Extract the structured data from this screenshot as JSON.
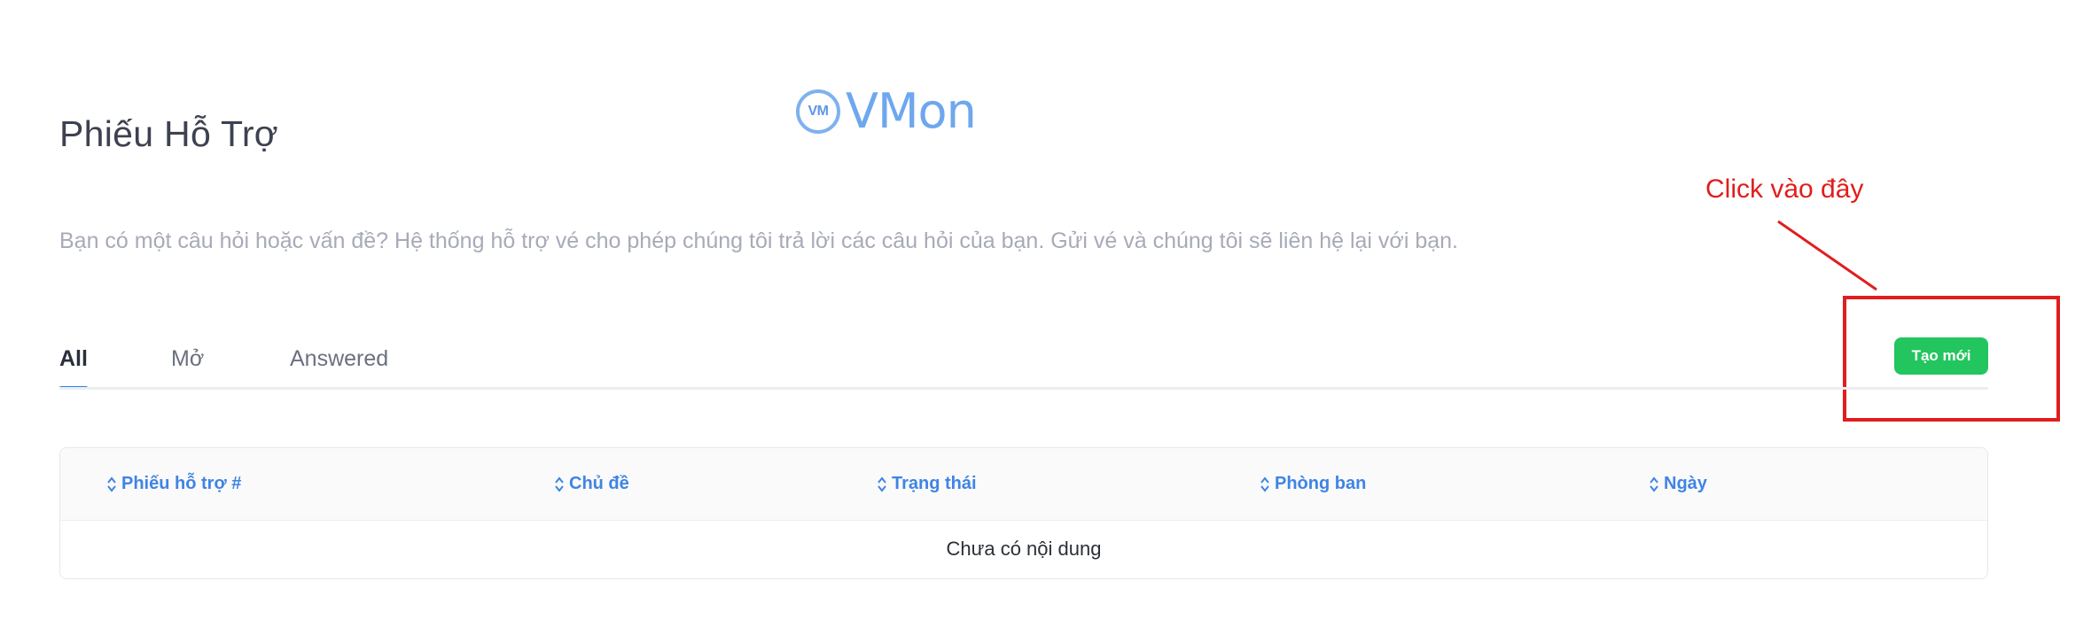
{
  "page": {
    "title": "Phiếu Hỗ Trợ",
    "description": "Bạn có một câu hỏi hoặc vấn đề? Hệ thống hỗ trợ vé cho phép chúng tôi trả lời các câu hỏi của bạn. Gửi vé và chúng tôi sẽ liên hệ lại với bạn."
  },
  "logo": {
    "badge": "VM",
    "text": "VMon",
    "color": "#6ea7ee"
  },
  "annotation": {
    "text": "Click vào đây",
    "color": "#e11d1d"
  },
  "tabs": [
    {
      "label": "All",
      "active": true
    },
    {
      "label": "Mở",
      "active": false
    },
    {
      "label": "Answered",
      "active": false
    }
  ],
  "actions": {
    "create_label": "Tạo mới",
    "create_color": "#22c55e"
  },
  "table": {
    "columns": [
      "Phiếu hỗ trợ #",
      "Chủ đề",
      "Trạng thái",
      "Phòng ban",
      "Ngày"
    ],
    "empty_text": "Chưa có nội dung",
    "sort_icon": "sort-icon"
  },
  "colors": {
    "accent": "#2f80ed",
    "header_text": "#3f84e5"
  }
}
